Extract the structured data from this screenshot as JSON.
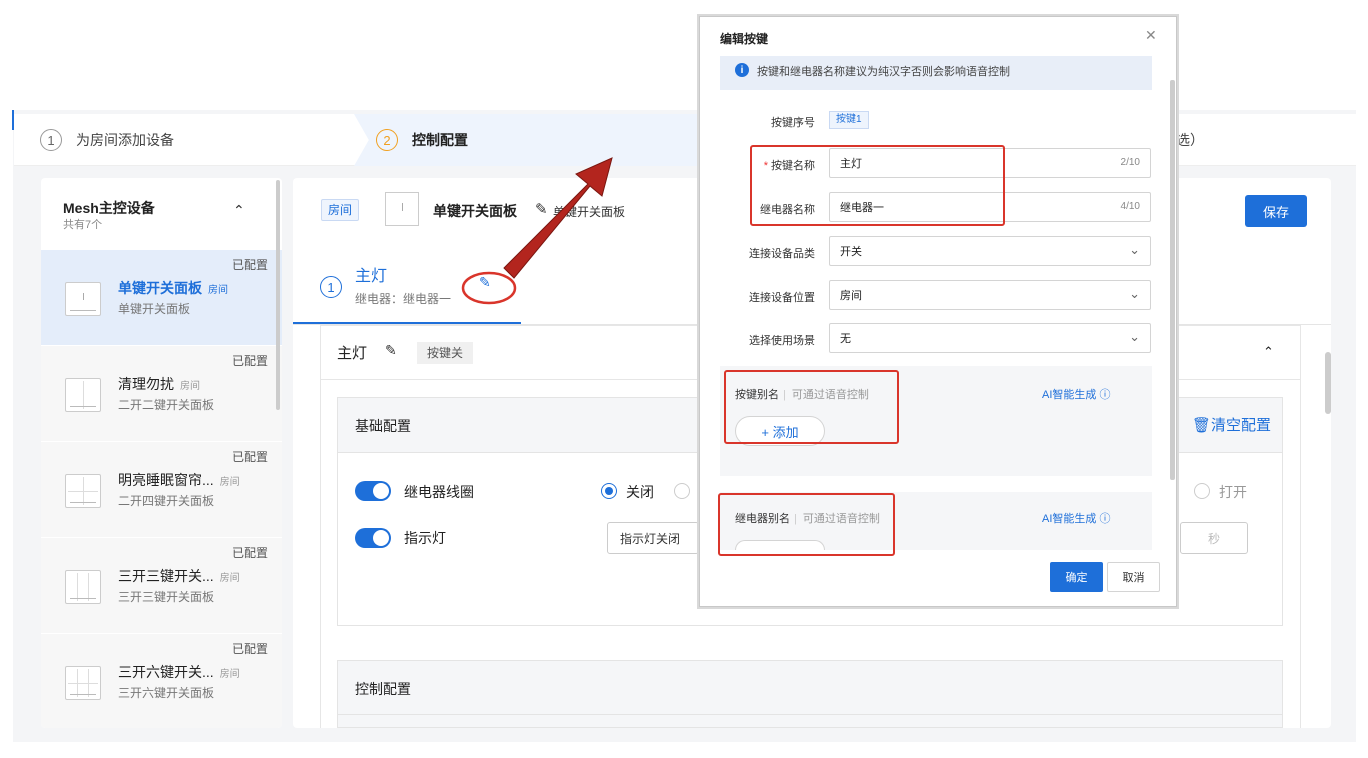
{
  "steps": [
    {
      "num": "1",
      "label": "为房间添加设备"
    },
    {
      "num": "2",
      "label": "控制配置"
    },
    {
      "num": "",
      "label": "选）"
    }
  ],
  "left_panel": {
    "title": "Mesh主控设备",
    "subtitle": "共有7个",
    "devices": [
      {
        "tag": "已配置",
        "name": "单键开关面板",
        "room": "房间",
        "model": "单键开关面板"
      },
      {
        "tag": "已配置",
        "name": "清理勿扰",
        "room": "房间",
        "model": "二开二键开关面板"
      },
      {
        "tag": "已配置",
        "name": "明亮睡眠窗帘...",
        "room": "房间",
        "model": "二开四键开关面板"
      },
      {
        "tag": "已配置",
        "name": "三开三键开关...",
        "room": "房间",
        "model": "三开三键开关面板"
      },
      {
        "tag": "已配置",
        "name": "三开六键开关...",
        "room": "房间",
        "model": "三开六键开关面板"
      }
    ]
  },
  "main": {
    "room_tag": "房间",
    "panel_name": "单键开关面板",
    "panel_model": "单键开关面板",
    "save_label": "保存",
    "key_tab": {
      "num": "1",
      "name": "主灯",
      "relay": "继电器：继电器一"
    },
    "section": {
      "title": "主灯",
      "badge": "按键关"
    },
    "basic": {
      "title": "基础配置",
      "clear_label": "清空配置",
      "relay_coil": "继电器线圈",
      "indicator": "指示灯",
      "radio_off": "关闭",
      "radio_on": "打开",
      "indicator_select": "指示灯关闭",
      "seconds": "秒"
    },
    "control": {
      "title": "控制配置"
    }
  },
  "modal": {
    "title": "编辑按键",
    "info": "按键和继电器名称建议为纯汉字否则会影响语音控制",
    "fields": {
      "key_index_label": "按键序号",
      "key_index_value": "按键1",
      "key_name_label": "按键名称",
      "key_name_value": "主灯",
      "key_name_count": "2/10",
      "relay_name_label": "继电器名称",
      "relay_name_value": "继电器一",
      "relay_name_count": "4/10",
      "device_type_label": "连接设备品类",
      "device_type_value": "开关",
      "device_pos_label": "连接设备位置",
      "device_pos_value": "房间",
      "scene_label": "选择使用场景",
      "scene_value": "无"
    },
    "key_alias": {
      "title": "按键别名",
      "hint": "可通过语音控制",
      "ai": "AI智能生成",
      "add": "+ 添加"
    },
    "relay_alias": {
      "title": "继电器别名",
      "hint": "可通过语音控制",
      "ai": "AI智能生成"
    },
    "ok": "确定",
    "cancel": "取消"
  },
  "colors": {
    "primary": "#1e6fd9",
    "annotation_red": "#d9352b",
    "arrow_red": "#b3251e"
  }
}
